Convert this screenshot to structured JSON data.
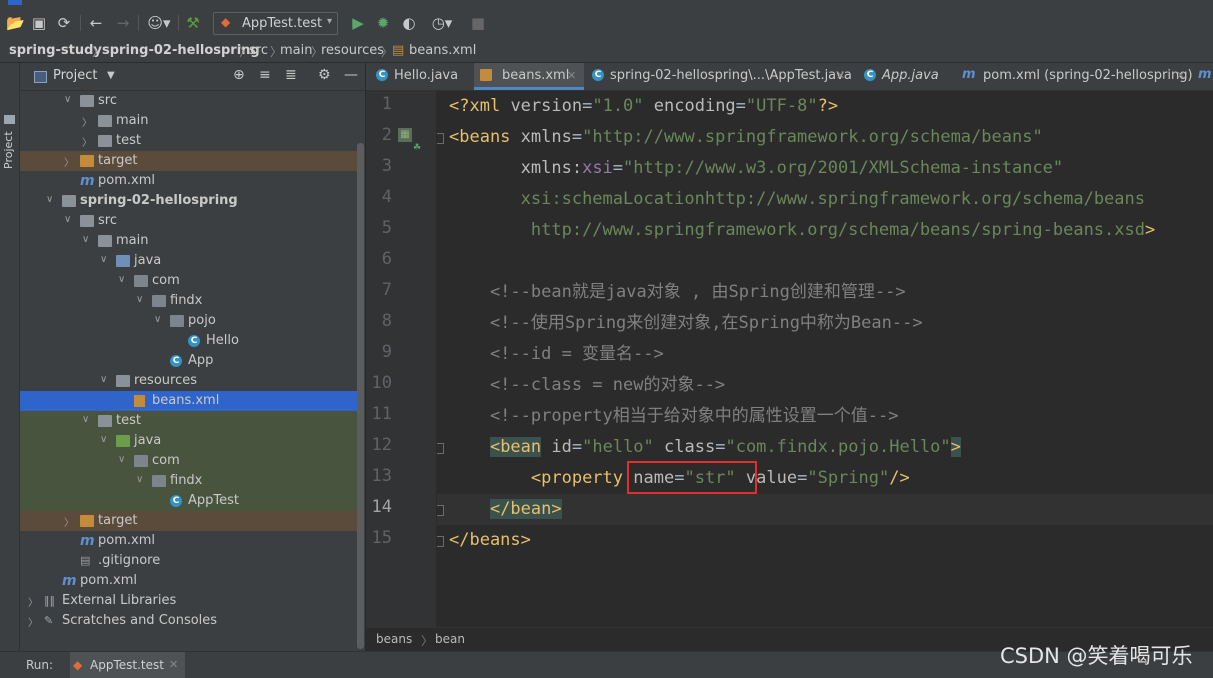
{
  "toolbar": {
    "run_config": "AppTest.test",
    "icons": [
      "open-icon",
      "save-icon",
      "sync-icon",
      "back-icon",
      "forward-icon",
      "user-icon",
      "build-icon",
      "run-icon",
      "debug-icon",
      "coverage-icon",
      "profile-icon",
      "stop-icon"
    ]
  },
  "breadcrumb": [
    "spring-study",
    "spring-02-hellospring",
    "src",
    "main",
    "resources",
    "beans.xml"
  ],
  "stripe": {
    "label": "Project"
  },
  "project_panel": {
    "title": "Project",
    "tree": [
      {
        "label": "src",
        "kind": "folder"
      },
      {
        "label": "main",
        "kind": "folder"
      },
      {
        "label": "test",
        "kind": "folder"
      },
      {
        "label": "target",
        "kind": "folder-excluded"
      },
      {
        "label": "pom.xml",
        "kind": "maven"
      },
      {
        "label": "spring-02-hellospring",
        "kind": "module"
      },
      {
        "label": "src",
        "kind": "folder"
      },
      {
        "label": "main",
        "kind": "folder"
      },
      {
        "label": "java",
        "kind": "source"
      },
      {
        "label": "com",
        "kind": "package"
      },
      {
        "label": "findx",
        "kind": "package"
      },
      {
        "label": "pojo",
        "kind": "package"
      },
      {
        "label": "Hello",
        "kind": "class"
      },
      {
        "label": "App",
        "kind": "class"
      },
      {
        "label": "resources",
        "kind": "resources"
      },
      {
        "label": "beans.xml",
        "kind": "xml"
      },
      {
        "label": "test",
        "kind": "folder"
      },
      {
        "label": "java",
        "kind": "test-source"
      },
      {
        "label": "com",
        "kind": "package"
      },
      {
        "label": "findx",
        "kind": "package"
      },
      {
        "label": "AppTest",
        "kind": "class"
      },
      {
        "label": "target",
        "kind": "folder-excluded"
      },
      {
        "label": "pom.xml",
        "kind": "maven"
      },
      {
        "label": ".gitignore",
        "kind": "file"
      },
      {
        "label": "pom.xml",
        "kind": "maven"
      },
      {
        "label": "External Libraries",
        "kind": "libraries"
      },
      {
        "label": "Scratches and Consoles",
        "kind": "scratches"
      }
    ]
  },
  "tabs": [
    {
      "label": "Hello.java"
    },
    {
      "label": "beans.xml"
    },
    {
      "label": "spring-02-hellospring\\...\\AppTest.java"
    },
    {
      "label": "App.java"
    },
    {
      "label": "pom.xml (spring-02-hellospring)"
    }
  ],
  "editor": {
    "line_numbers": [
      "1",
      "2",
      "3",
      "4",
      "5",
      "6",
      "7",
      "8",
      "9",
      "10",
      "11",
      "12",
      "13",
      "14",
      "15"
    ],
    "current_line": "14",
    "lines": [
      "<?xml version=\"1.0\" encoding=\"UTF-8\"?>",
      "<beans xmlns=\"http://www.springframework.org/schema/beans\"",
      "       xmlns:xsi=\"http://www.w3.org/2001/XMLSchema-instance\"",
      "       xsi:schemaLocation=\"http://www.springframework.org/schema/beans",
      "        http://www.springframework.org/schema/beans/spring-beans.xsd\">",
      "",
      "    <!--bean就是java对象 , 由Spring创建和管理-->",
      "    <!--使用Spring来创建对象,在Spring中称为Bean-->",
      "    <!--id = 变量名-->",
      "    <!--class = new的对象-->",
      "    <!--property相当于给对象中的属性设置一个值-->",
      "    <bean id=\"hello\" class=\"com.findx.pojo.Hello\">",
      "        <property name=\"str\" value=\"Spring\"/>",
      "    </bean>",
      "</beans>"
    ]
  },
  "editor_breadcrumb": [
    "beans",
    "bean"
  ],
  "run_bar": {
    "label": "Run:",
    "tab": "AppTest.test"
  },
  "watermark": "CSDN @笑着喝可乐"
}
